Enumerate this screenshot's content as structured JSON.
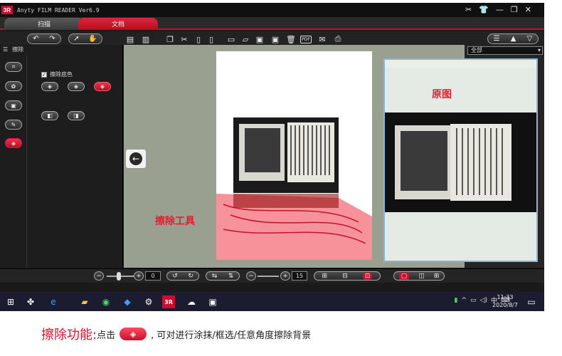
{
  "app": {
    "logo": "3R",
    "title": "Anyty FILM READER Ver6.9",
    "window_controls": [
      "✕",
      "👕",
      "—",
      "❐",
      "✕"
    ]
  },
  "tabs": [
    {
      "label": "扫描",
      "active": false
    },
    {
      "label": "文档",
      "active": true
    }
  ],
  "left_panel": {
    "header": "擦除",
    "checkbox_label": "擦除底色",
    "checkbox_checked": true
  },
  "right_panel": {
    "dropdown_value": "全部"
  },
  "bottom_bar": {
    "rotate_value": "0",
    "zoom_value": "15"
  },
  "taskbar": {
    "time": "11:33",
    "date": "2020/8/7",
    "ime": "中"
  },
  "annotations": {
    "original_label": "原图",
    "tool_label": "擦除工具"
  },
  "caption": {
    "title": "擦除功能:",
    "prefix": "点击",
    "suffix": ", 可对进行涂抹/框选/任意角度擦除背景"
  },
  "colors": {
    "accent": "#c8102e",
    "erase_overlay": "#f26d78",
    "workspace": "#9aa090"
  }
}
